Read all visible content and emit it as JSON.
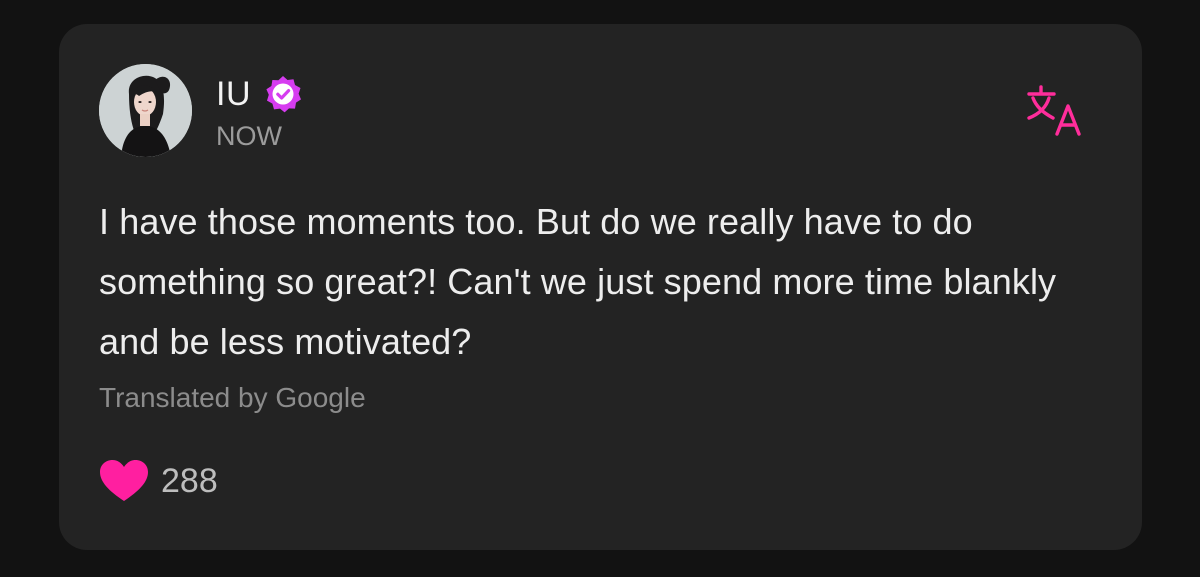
{
  "post": {
    "author": {
      "name": "IU",
      "verified": true,
      "avatar": "profile-photo"
    },
    "timestamp": "NOW",
    "text": "I have those moments too. But do we really have to do something so great?! Can't we just spend more time blankly and be less motivated?",
    "translation_note": "Translated by Google",
    "likes": "288"
  },
  "icons": {
    "verified_badge": "verified-badge-icon",
    "translate": "translate-icon",
    "like": "heart-icon"
  },
  "colors": {
    "background": "#121212",
    "card": "#232323",
    "accent": "#ff2d9b",
    "badge": "#d63cf0",
    "text_primary": "#ededed",
    "text_secondary": "#8c8c8c"
  }
}
